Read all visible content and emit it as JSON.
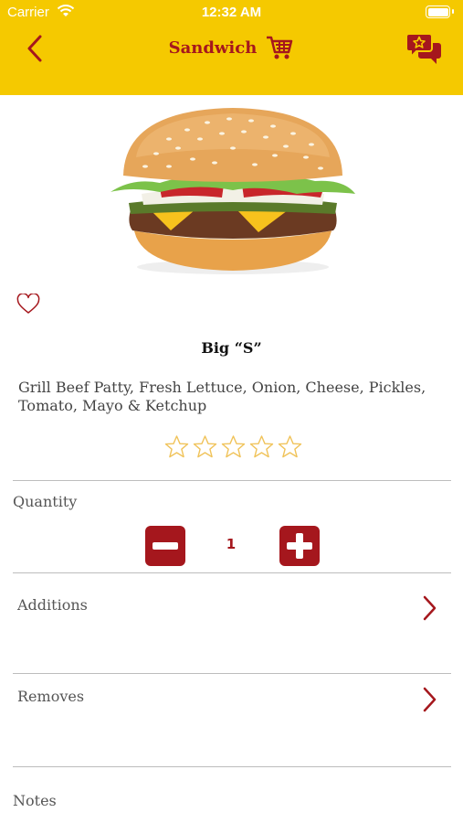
{
  "status_bar": {
    "carrier": "Carrier",
    "time": "12:32 AM"
  },
  "header": {
    "title": "Sandwich",
    "icons": [
      "back-chevron-icon",
      "cart-icon",
      "chat-star-icon"
    ]
  },
  "product": {
    "name": "Big “S”",
    "description": "Grill Beef Patty, Fresh Lettuce, Onion, Cheese, Pickles, Tomato, Mayo & Ketchup",
    "rating_filled": 0,
    "rating_max": 5,
    "favorite": false
  },
  "quantity": {
    "label": "Quantity",
    "value": "1"
  },
  "options": {
    "additions_label": "Additions",
    "removes_label": "Removes",
    "notes_label": "Notes"
  },
  "colors": {
    "header_bg": "#f5c900",
    "accent": "#a5171d",
    "star_outline": "#f0c35a"
  }
}
